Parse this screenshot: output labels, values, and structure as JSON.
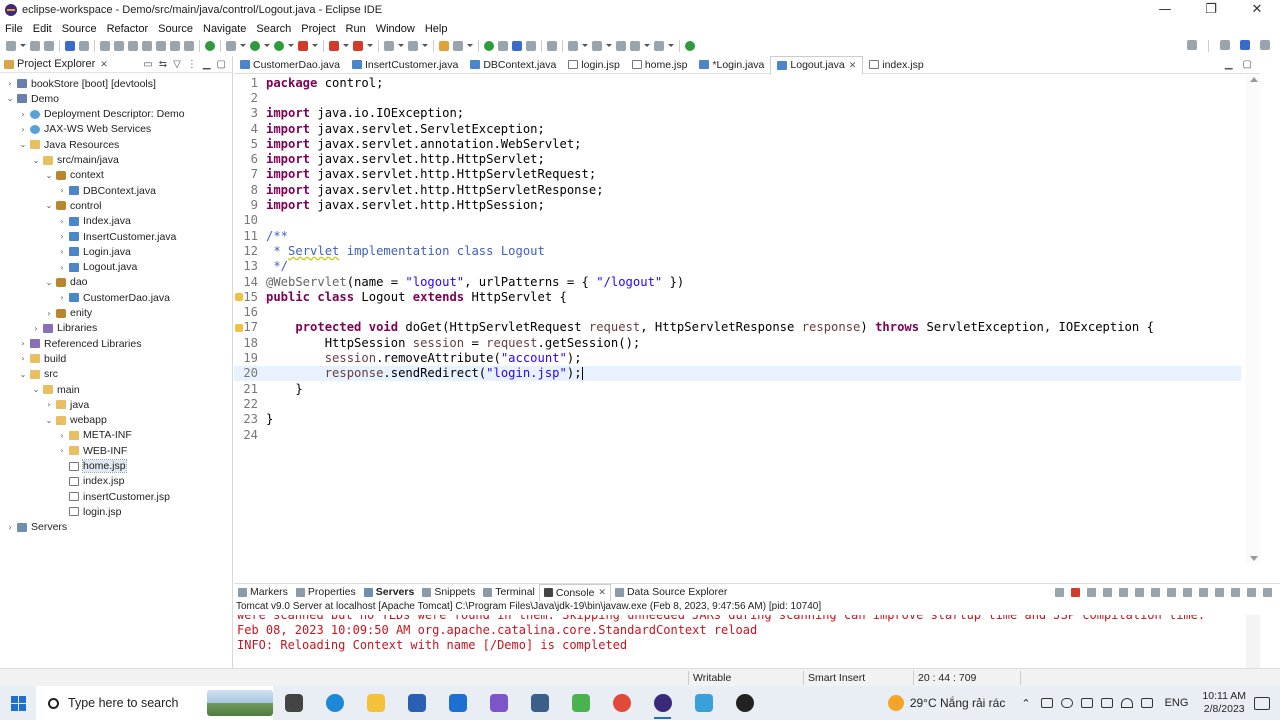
{
  "window": {
    "title": "eclipse-workspace - Demo/src/main/java/control/Logout.java - Eclipse IDE",
    "controls": [
      "—",
      "❐",
      "✕"
    ]
  },
  "menu": [
    "File",
    "Edit",
    "Source",
    "Refactor",
    "Source",
    "Navigate",
    "Search",
    "Project",
    "Run",
    "Window",
    "Help"
  ],
  "explorer": {
    "title": "Project Explorer",
    "close": "✕",
    "tree": [
      {
        "label": "bookStore [boot] [devtools]",
        "level": 0,
        "expanded": false,
        "icon": "project"
      },
      {
        "label": "Demo",
        "level": 0,
        "expanded": true,
        "icon": "project"
      },
      {
        "label": "Deployment Descriptor: Demo",
        "level": 1,
        "expanded": false,
        "icon": "web"
      },
      {
        "label": "JAX-WS Web Services",
        "level": 1,
        "expanded": false,
        "icon": "web"
      },
      {
        "label": "Java Resources",
        "level": 1,
        "expanded": true,
        "icon": "folder"
      },
      {
        "label": "src/main/java",
        "level": 2,
        "expanded": true,
        "icon": "folder"
      },
      {
        "label": "context",
        "level": 3,
        "expanded": true,
        "icon": "pkg"
      },
      {
        "label": "DBContext.java",
        "level": 4,
        "expanded": false,
        "icon": "java"
      },
      {
        "label": "control",
        "level": 3,
        "expanded": true,
        "icon": "pkg"
      },
      {
        "label": "Index.java",
        "level": 4,
        "expanded": false,
        "icon": "java"
      },
      {
        "label": "InsertCustomer.java",
        "level": 4,
        "expanded": false,
        "icon": "java"
      },
      {
        "label": "Login.java",
        "level": 4,
        "expanded": false,
        "icon": "java"
      },
      {
        "label": "Logout.java",
        "level": 4,
        "expanded": false,
        "icon": "java"
      },
      {
        "label": "dao",
        "level": 3,
        "expanded": true,
        "icon": "pkg"
      },
      {
        "label": "CustomerDao.java",
        "level": 4,
        "expanded": false,
        "icon": "java"
      },
      {
        "label": "enity",
        "level": 3,
        "expanded": false,
        "icon": "pkg"
      },
      {
        "label": "Libraries",
        "level": 2,
        "expanded": false,
        "icon": "lib"
      },
      {
        "label": "Referenced Libraries",
        "level": 1,
        "expanded": false,
        "icon": "lib"
      },
      {
        "label": "build",
        "level": 1,
        "expanded": false,
        "icon": "folder"
      },
      {
        "label": "src",
        "level": 1,
        "expanded": true,
        "icon": "folder"
      },
      {
        "label": "main",
        "level": 2,
        "expanded": true,
        "icon": "folder"
      },
      {
        "label": "java",
        "level": 3,
        "expanded": false,
        "icon": "folder"
      },
      {
        "label": "webapp",
        "level": 3,
        "expanded": true,
        "icon": "folder"
      },
      {
        "label": "META-INF",
        "level": 4,
        "expanded": false,
        "icon": "folder"
      },
      {
        "label": "WEB-INF",
        "level": 4,
        "expanded": false,
        "icon": "folder"
      },
      {
        "label": "home.jsp",
        "level": 4,
        "leaf": true,
        "icon": "jsp",
        "selected": true
      },
      {
        "label": "index.jsp",
        "level": 4,
        "leaf": true,
        "icon": "jsp"
      },
      {
        "label": "insertCustomer.jsp",
        "level": 4,
        "leaf": true,
        "icon": "jsp"
      },
      {
        "label": "login.jsp",
        "level": 4,
        "leaf": true,
        "icon": "jsp"
      },
      {
        "label": "Servers",
        "level": 0,
        "expanded": false,
        "icon": "srv"
      }
    ]
  },
  "editor_tabs": [
    {
      "label": "CustomerDao.java",
      "icon": "java"
    },
    {
      "label": "InsertCustomer.java",
      "icon": "java"
    },
    {
      "label": "DBContext.java",
      "icon": "java"
    },
    {
      "label": "login.jsp",
      "icon": "jsp"
    },
    {
      "label": "home.jsp",
      "icon": "jsp"
    },
    {
      "label": "*Login.java",
      "icon": "java"
    },
    {
      "label": "Logout.java",
      "icon": "java",
      "active": true
    },
    {
      "label": "index.jsp",
      "icon": "jsp"
    }
  ],
  "editor": {
    "current_line": 20,
    "lines": [
      {
        "n": "1",
        "html": "<span class=\"kw\">package</span> control;"
      },
      {
        "n": "2",
        "html": ""
      },
      {
        "n": "3",
        "html": "<span class=\"kw\">import</span> java.io.IOException;"
      },
      {
        "n": "4",
        "html": "<span class=\"kw\">import</span> javax.servlet.ServletException;"
      },
      {
        "n": "5",
        "html": "<span class=\"kw\">import</span> javax.servlet.annotation.WebServlet;"
      },
      {
        "n": "6",
        "html": "<span class=\"kw\">import</span> javax.servlet.http.HttpServlet;"
      },
      {
        "n": "7",
        "html": "<span class=\"kw\">import</span> javax.servlet.http.HttpServletRequest;"
      },
      {
        "n": "8",
        "html": "<span class=\"kw\">import</span> javax.servlet.http.HttpServletResponse;"
      },
      {
        "n": "9",
        "html": "<span class=\"kw\">import</span> javax.servlet.http.HttpSession;"
      },
      {
        "n": "10",
        "html": ""
      },
      {
        "n": "11",
        "html": "<span class=\"cm\">/**</span>"
      },
      {
        "n": "12",
        "html": "<span class=\"cm\"> * <span class=\"sq\">Servlet</span> implementation class Logout</span>"
      },
      {
        "n": "13",
        "html": "<span class=\"cm\"> */</span>"
      },
      {
        "n": "14",
        "html": "<span class=\"ann\">@WebServlet</span>(name = <span class=\"str\">\"logout\"</span>, urlPatterns = { <span class=\"str\">\"/logout\"</span> })"
      },
      {
        "n": "15",
        "html": "<span class=\"kw\">public class</span> Logout <span class=\"kw\">extends</span> HttpServlet {"
      },
      {
        "n": "16",
        "html": ""
      },
      {
        "n": "17",
        "html": "    <span class=\"kw\">protected void</span> doGet(HttpServletRequest <span style=\"color:#6a3e3e\">request</span>, HttpServletResponse <span style=\"color:#6a3e3e\">response</span>) <span class=\"kw\">throws</span> ServletException, IOException {"
      },
      {
        "n": "18",
        "html": "        HttpSession <span style=\"color:#6a3e3e\">session</span> = <span style=\"color:#6a3e3e\">request</span>.getSession();"
      },
      {
        "n": "19",
        "html": "        <span style=\"color:#6a3e3e\">session</span>.removeAttribute(<span class=\"str\">\"account\"</span>);"
      },
      {
        "n": "20",
        "html": "        <span style=\"color:#6a3e3e\">response</span>.sendRedirect(<span class=\"str\">\"login.jsp\"</span>);<span class=\"cursor\"></span>"
      },
      {
        "n": "21",
        "html": "    }"
      },
      {
        "n": "22",
        "html": ""
      },
      {
        "n": "23",
        "html": "}"
      },
      {
        "n": "24",
        "html": ""
      }
    ]
  },
  "bottom_tabs": [
    {
      "label": "Markers"
    },
    {
      "label": "Properties"
    },
    {
      "label": "Servers",
      "bold": true
    },
    {
      "label": "Snippets"
    },
    {
      "label": "Terminal"
    },
    {
      "label": "Console",
      "console": true
    },
    {
      "label": "Data Source Explorer"
    }
  ],
  "console": {
    "header": "Tomcat v9.0 Server at localhost [Apache Tomcat] C:\\Program Files\\Java\\jdk-19\\bin\\javaw.exe  (Feb 8, 2023, 9:47:56 AM) [pid: 10740]",
    "lines": [
      "were scanned but no TLDs were found in them. Skipping unneeded JARs during scanning can improve startup time and JSP compilation time.",
      "Feb 08, 2023 10:09:50 AM org.apache.catalina.core.StandardContext reload",
      "INFO: Reloading Context with name [/Demo] is completed"
    ]
  },
  "status": {
    "writable": "Writable",
    "insert_mode": "Smart Insert",
    "position": "20 : 44 : 709"
  },
  "taskbar": {
    "search_placeholder": "Type here to search",
    "weather": "29°C  Nắng rải rác",
    "language": "ENG",
    "time": "10:11 AM",
    "date": "2/8/2023",
    "apps": [
      {
        "name": "task-view",
        "color": "#444444"
      },
      {
        "name": "edge",
        "color": "#1e88d8"
      },
      {
        "name": "file-explorer",
        "color": "#f3c13a"
      },
      {
        "name": "store",
        "color": "#2b5fb4"
      },
      {
        "name": "mail",
        "color": "#1d6fd0"
      },
      {
        "name": "visual-studio",
        "color": "#7b55c9"
      },
      {
        "name": "mysql-workbench",
        "color": "#3a5f88"
      },
      {
        "name": "sourcetree",
        "color": "#4bb34e"
      },
      {
        "name": "chrome",
        "color": "#e04a3a"
      },
      {
        "name": "eclipse",
        "color": "#3b2a7a",
        "active": true
      },
      {
        "name": "snipping",
        "color": "#3aa0d8"
      },
      {
        "name": "obs",
        "color": "#222222"
      }
    ]
  }
}
